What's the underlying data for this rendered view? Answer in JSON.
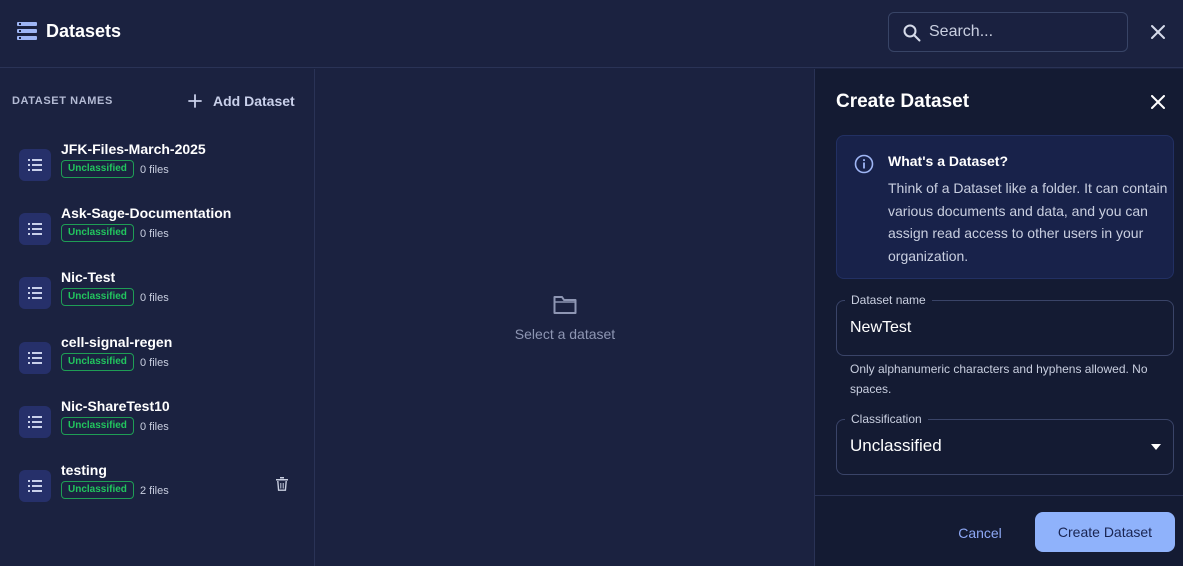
{
  "header": {
    "title": "Datasets",
    "search_placeholder": "Search..."
  },
  "sidebar": {
    "heading": "DATASET NAMES",
    "add_label": "Add Dataset",
    "items": [
      {
        "name": "JFK-Files-March-2025",
        "badge": "Unclassified",
        "files": "0 files"
      },
      {
        "name": "Ask-Sage-Documentation",
        "badge": "Unclassified",
        "files": "0 files"
      },
      {
        "name": "Nic-Test",
        "badge": "Unclassified",
        "files": "0 files"
      },
      {
        "name": "cell-signal-regen",
        "badge": "Unclassified",
        "files": "0 files"
      },
      {
        "name": "Nic-ShareTest10",
        "badge": "Unclassified",
        "files": "0 files"
      },
      {
        "name": "testing",
        "badge": "Unclassified",
        "files": "2 files"
      }
    ]
  },
  "center": {
    "empty_text": "Select a dataset"
  },
  "panel": {
    "title": "Create Dataset",
    "info_title": "What's a Dataset?",
    "info_text": "Think of a Dataset like a folder. It can contain various documents and data, and you can assign read access to other users in your organization.",
    "name_label": "Dataset name",
    "name_value": "NewTest",
    "name_hint": "Only alphanumeric characters and hyphens allowed. No spaces.",
    "classification_label": "Classification",
    "classification_value": "Unclassified",
    "cancel_label": "Cancel",
    "create_label": "Create Dataset"
  },
  "colors": {
    "background": "#1b2240",
    "panel": "#141b33",
    "badge_green": "#22c55e",
    "accent_button": "#8fb2fb",
    "link_blue": "#8ea8f5"
  },
  "icons": {
    "header": "list-icon",
    "search": "search-icon",
    "close": "close-icon",
    "add": "plus-icon",
    "item": "list-icon",
    "delete": "trash-icon",
    "empty": "folder-icon",
    "info": "info-icon",
    "select": "caret-down-icon"
  }
}
